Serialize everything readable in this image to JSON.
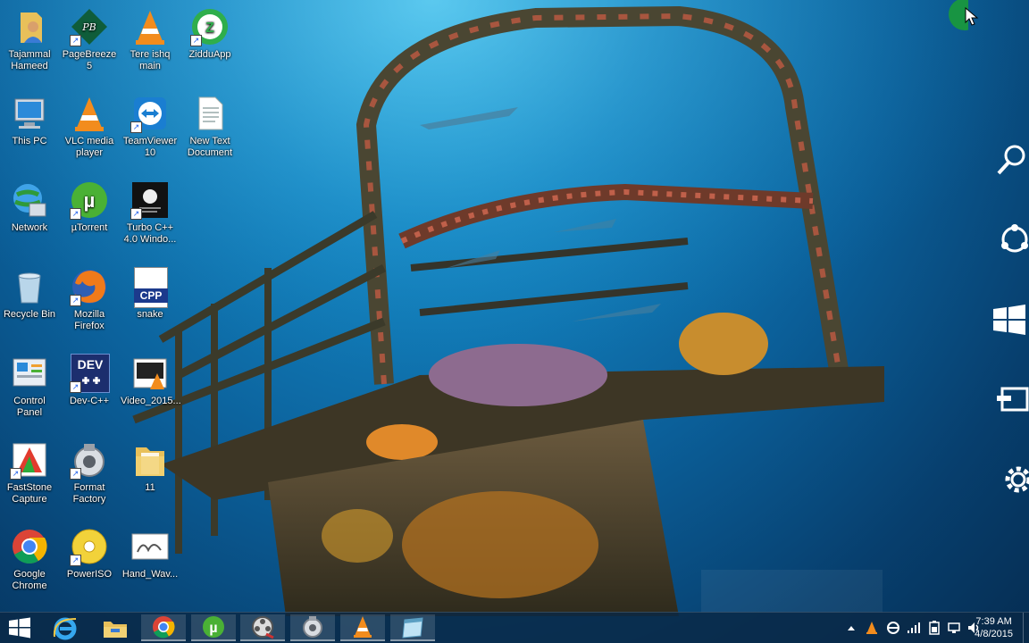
{
  "desktop": {
    "icons": [
      {
        "label": "Tajammal Hameed",
        "icon": "user-folder-icon"
      },
      {
        "label": "PageBreeze 5",
        "icon": "pagebreeze-icon"
      },
      {
        "label": "Tere ishq main",
        "icon": "vlc-file-icon"
      },
      {
        "label": "ZidduApp",
        "icon": "ziddu-icon"
      },
      {
        "label": "This PC",
        "icon": "computer-icon"
      },
      {
        "label": "VLC media player",
        "icon": "vlc-icon"
      },
      {
        "label": "TeamViewer 10",
        "icon": "teamviewer-icon"
      },
      {
        "label": "New Text Document",
        "icon": "text-document-icon"
      },
      {
        "label": "Network",
        "icon": "network-icon"
      },
      {
        "label": "µTorrent",
        "icon": "utorrent-icon"
      },
      {
        "label": "Turbo C++ 4.0 Windo...",
        "icon": "turbo-cpp-icon"
      },
      {
        "label": "Recycle Bin",
        "icon": "recycle-bin-icon"
      },
      {
        "label": "Mozilla Firefox",
        "icon": "firefox-icon"
      },
      {
        "label": "snake",
        "icon": "cpp-file-icon",
        "badge": "CPP"
      },
      {
        "label": "Control Panel",
        "icon": "control-panel-icon"
      },
      {
        "label": "Dev-C++",
        "icon": "devcpp-icon",
        "badge": "DEV"
      },
      {
        "label": "Video_2015...",
        "icon": "video-file-icon"
      },
      {
        "label": "FastStone Capture",
        "icon": "faststone-icon"
      },
      {
        "label": "Format Factory",
        "icon": "format-factory-icon"
      },
      {
        "label": "11",
        "icon": "folder-icon"
      },
      {
        "label": "Google Chrome",
        "icon": "chrome-icon"
      },
      {
        "label": "PowerISO",
        "icon": "poweriso-icon"
      },
      {
        "label": "Hand_Wav...",
        "icon": "image-file-icon"
      }
    ]
  },
  "charms": [
    {
      "name": "search-charm",
      "icon": "search-icon"
    },
    {
      "name": "share-charm",
      "icon": "share-icon"
    },
    {
      "name": "start-charm",
      "icon": "windows-icon"
    },
    {
      "name": "devices-charm",
      "icon": "devices-icon"
    },
    {
      "name": "settings-charm",
      "icon": "gear-icon"
    }
  ],
  "taskbar": {
    "start": {
      "icon": "windows-logo-icon"
    },
    "pinned": [
      {
        "name": "internet-explorer",
        "icon": "internet-explorer-icon"
      },
      {
        "name": "file-explorer",
        "icon": "file-explorer-icon"
      },
      {
        "name": "chrome",
        "icon": "chrome-icon"
      },
      {
        "name": "utorrent",
        "icon": "utorrent-icon"
      },
      {
        "name": "video-editor",
        "icon": "film-reel-icon"
      },
      {
        "name": "format-factory",
        "icon": "format-factory-icon"
      },
      {
        "name": "vlc",
        "icon": "vlc-icon"
      },
      {
        "name": "window-app",
        "icon": "window-icon"
      }
    ],
    "tray_icons": [
      "show-hidden-icon",
      "vlc-tray-icon",
      "sync-icon",
      "signal-icon",
      "battery-icon",
      "network-tray-icon",
      "volume-icon"
    ],
    "clock": {
      "time": "7:39 AM",
      "date": "4/8/2015"
    }
  },
  "colors": {
    "sea_top": "#2fb6e8",
    "sea_bottom": "#052d52",
    "taskbar": "#0a2846",
    "cursor_highlight": "#1a9a3a"
  }
}
